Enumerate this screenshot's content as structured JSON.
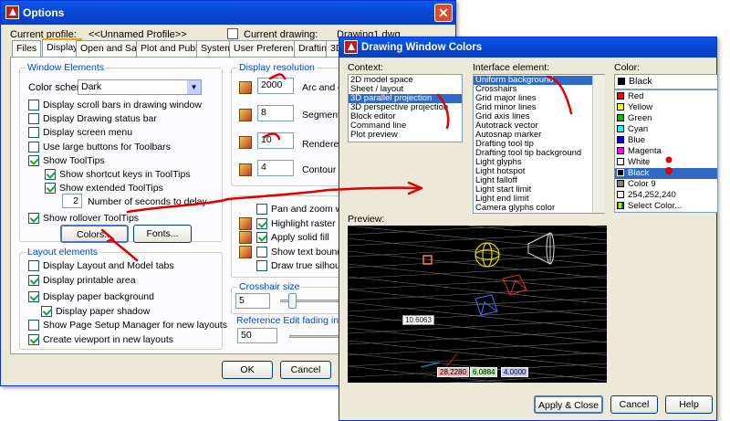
{
  "options_window": {
    "title": "Options",
    "current_profile_label": "Current profile:",
    "current_profile_value": "<<Unnamed Profile>>",
    "current_drawing_label": "Current drawing:",
    "current_drawing_value": "Drawing1.dwg",
    "tabs": [
      "Files",
      "Display",
      "Open and Save",
      "Plot and Publish",
      "System",
      "User Preferences",
      "Drafting",
      "3D"
    ],
    "window_elements": {
      "title": "Window Elements",
      "color_scheme_label": "Color scheme:",
      "color_scheme_value": "Dark",
      "options": [
        {
          "label": "Display scroll bars in drawing window",
          "checked": false
        },
        {
          "label": "Display Drawing status bar",
          "checked": false
        },
        {
          "label": "Display screen menu",
          "checked": false
        },
        {
          "label": "Use large buttons for Toolbars",
          "checked": false
        },
        {
          "label": "Show ToolTips",
          "checked": true
        },
        {
          "label": "Show shortcut keys in ToolTips",
          "checked": true
        },
        {
          "label": "Show extended ToolTips",
          "checked": true
        },
        {
          "label": "Number of seconds to delay",
          "value": "2"
        },
        {
          "label": "Show rollover ToolTips",
          "checked": true
        }
      ],
      "colors_button": "Colors...",
      "fonts_button": "Fonts..."
    },
    "layout_elements": {
      "title": "Layout elements",
      "options": [
        {
          "label": "Display Layout and Model tabs",
          "checked": false
        },
        {
          "label": "Display printable area",
          "checked": true
        },
        {
          "label": "Display paper background",
          "checked": true
        },
        {
          "label": "Display paper shadow",
          "checked": true
        },
        {
          "label": "Show Page Setup Manager for new layouts",
          "checked": false
        },
        {
          "label": "Create viewport in new layouts",
          "checked": true
        }
      ]
    },
    "display_resolution": {
      "title": "Display resolution",
      "rows": [
        {
          "value": "2000",
          "label": "Arc and circ"
        },
        {
          "value": "8",
          "label": "Segments"
        },
        {
          "value": "10",
          "label": "Rendered"
        },
        {
          "value": "4",
          "label": "Contour lin"
        }
      ]
    },
    "display_performance": {
      "options": [
        {
          "label": "Pan and zoom with ra",
          "checked": false
        },
        {
          "label": "Highlight raster image",
          "checked": true
        },
        {
          "label": "Apply solid fill",
          "checked": true
        },
        {
          "label": "Show text boundary f",
          "checked": false
        },
        {
          "label": "Draw true silhouettes",
          "checked": false
        }
      ]
    },
    "crosshair": {
      "title": "Crosshair size",
      "value": "5"
    },
    "refedit": {
      "title": "Reference Edit fading intensity",
      "value": "50"
    },
    "ok_button": "OK",
    "cancel_button": "Cancel"
  },
  "colors_window": {
    "title": "Drawing Window Colors",
    "context_label": "Context:",
    "contexts": [
      "2D model space",
      "Sheet / layout",
      "3D parallel projection",
      "3D perspective projection",
      "Block editor",
      "Command line",
      "Plot preview"
    ],
    "context_selected": 2,
    "interface_label": "Interface element:",
    "interface_elements": [
      "Uniform background",
      "Crosshairs",
      "Grid major lines",
      "Grid minor lines",
      "Grid axis lines",
      "Autotrack vector",
      "Autosnap marker",
      "Drafting tool tip",
      "Drafting tool tip background",
      "Light glyphs",
      "Light hotspot",
      "Light falloff",
      "Light start limit",
      "Light end limit",
      "Camera glyphs color"
    ],
    "interface_selected": 0,
    "color_label": "Color:",
    "color_value": "Black",
    "color_options": [
      {
        "name": "Red",
        "hex": "#ff0000"
      },
      {
        "name": "Yellow",
        "hex": "#ffff00"
      },
      {
        "name": "Green",
        "hex": "#00c000"
      },
      {
        "name": "Cyan",
        "hex": "#00ffff"
      },
      {
        "name": "Blue",
        "hex": "#0000ff"
      },
      {
        "name": "Magenta",
        "hex": "#ff00ff"
      },
      {
        "name": "White",
        "hex": "#ffffff"
      },
      {
        "name": "Black",
        "hex": "#000000"
      },
      {
        "name": "Color 9",
        "hex": "#808080"
      },
      {
        "name": "254,252,240",
        "hex": "#fefcf0"
      },
      {
        "name": "Select Color...",
        "hex": ""
      }
    ],
    "color_selected": 7,
    "preview_label": "Preview:",
    "preview_tags": [
      "10.6063",
      "28.2280",
      "6.0884",
      "4.0000"
    ],
    "apply_button": "Apply & Close",
    "cancel_button": "Cancel",
    "help_button": "Help"
  },
  "annotation_color": "#e00000"
}
